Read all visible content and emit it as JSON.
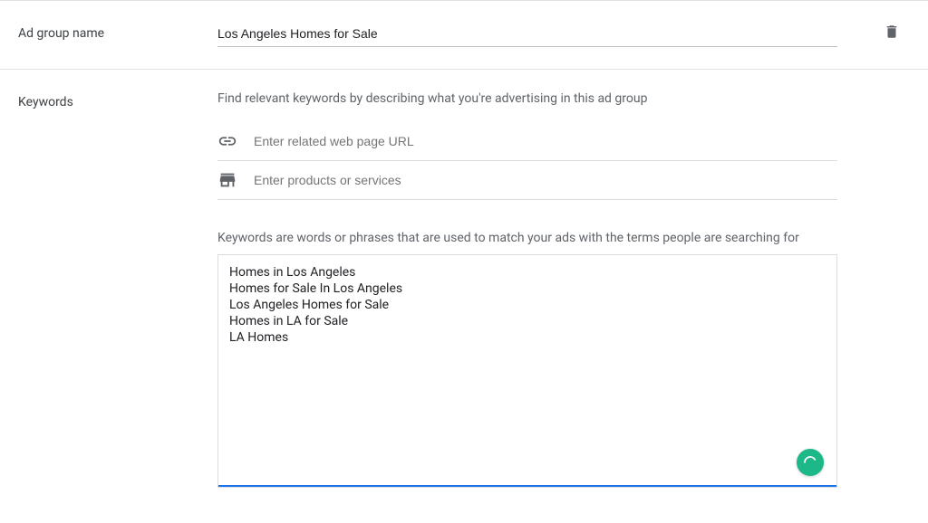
{
  "sections": {
    "ad_group": {
      "label": "Ad group name",
      "value": "Los Angeles Homes for Sale"
    },
    "keywords": {
      "label": "Keywords",
      "helper": "Find relevant keywords by describing what you're advertising in this ad group",
      "url_placeholder": "Enter related web page URL",
      "products_placeholder": "Enter products or services",
      "info_text": "Keywords are words or phrases that are used to match your ads with the terms people are searching for",
      "textarea_value": "Homes in Los Angeles\nHomes for Sale In Los Angeles\nLos Angeles Homes for Sale\nHomes in LA for Sale\nLA Homes"
    }
  }
}
